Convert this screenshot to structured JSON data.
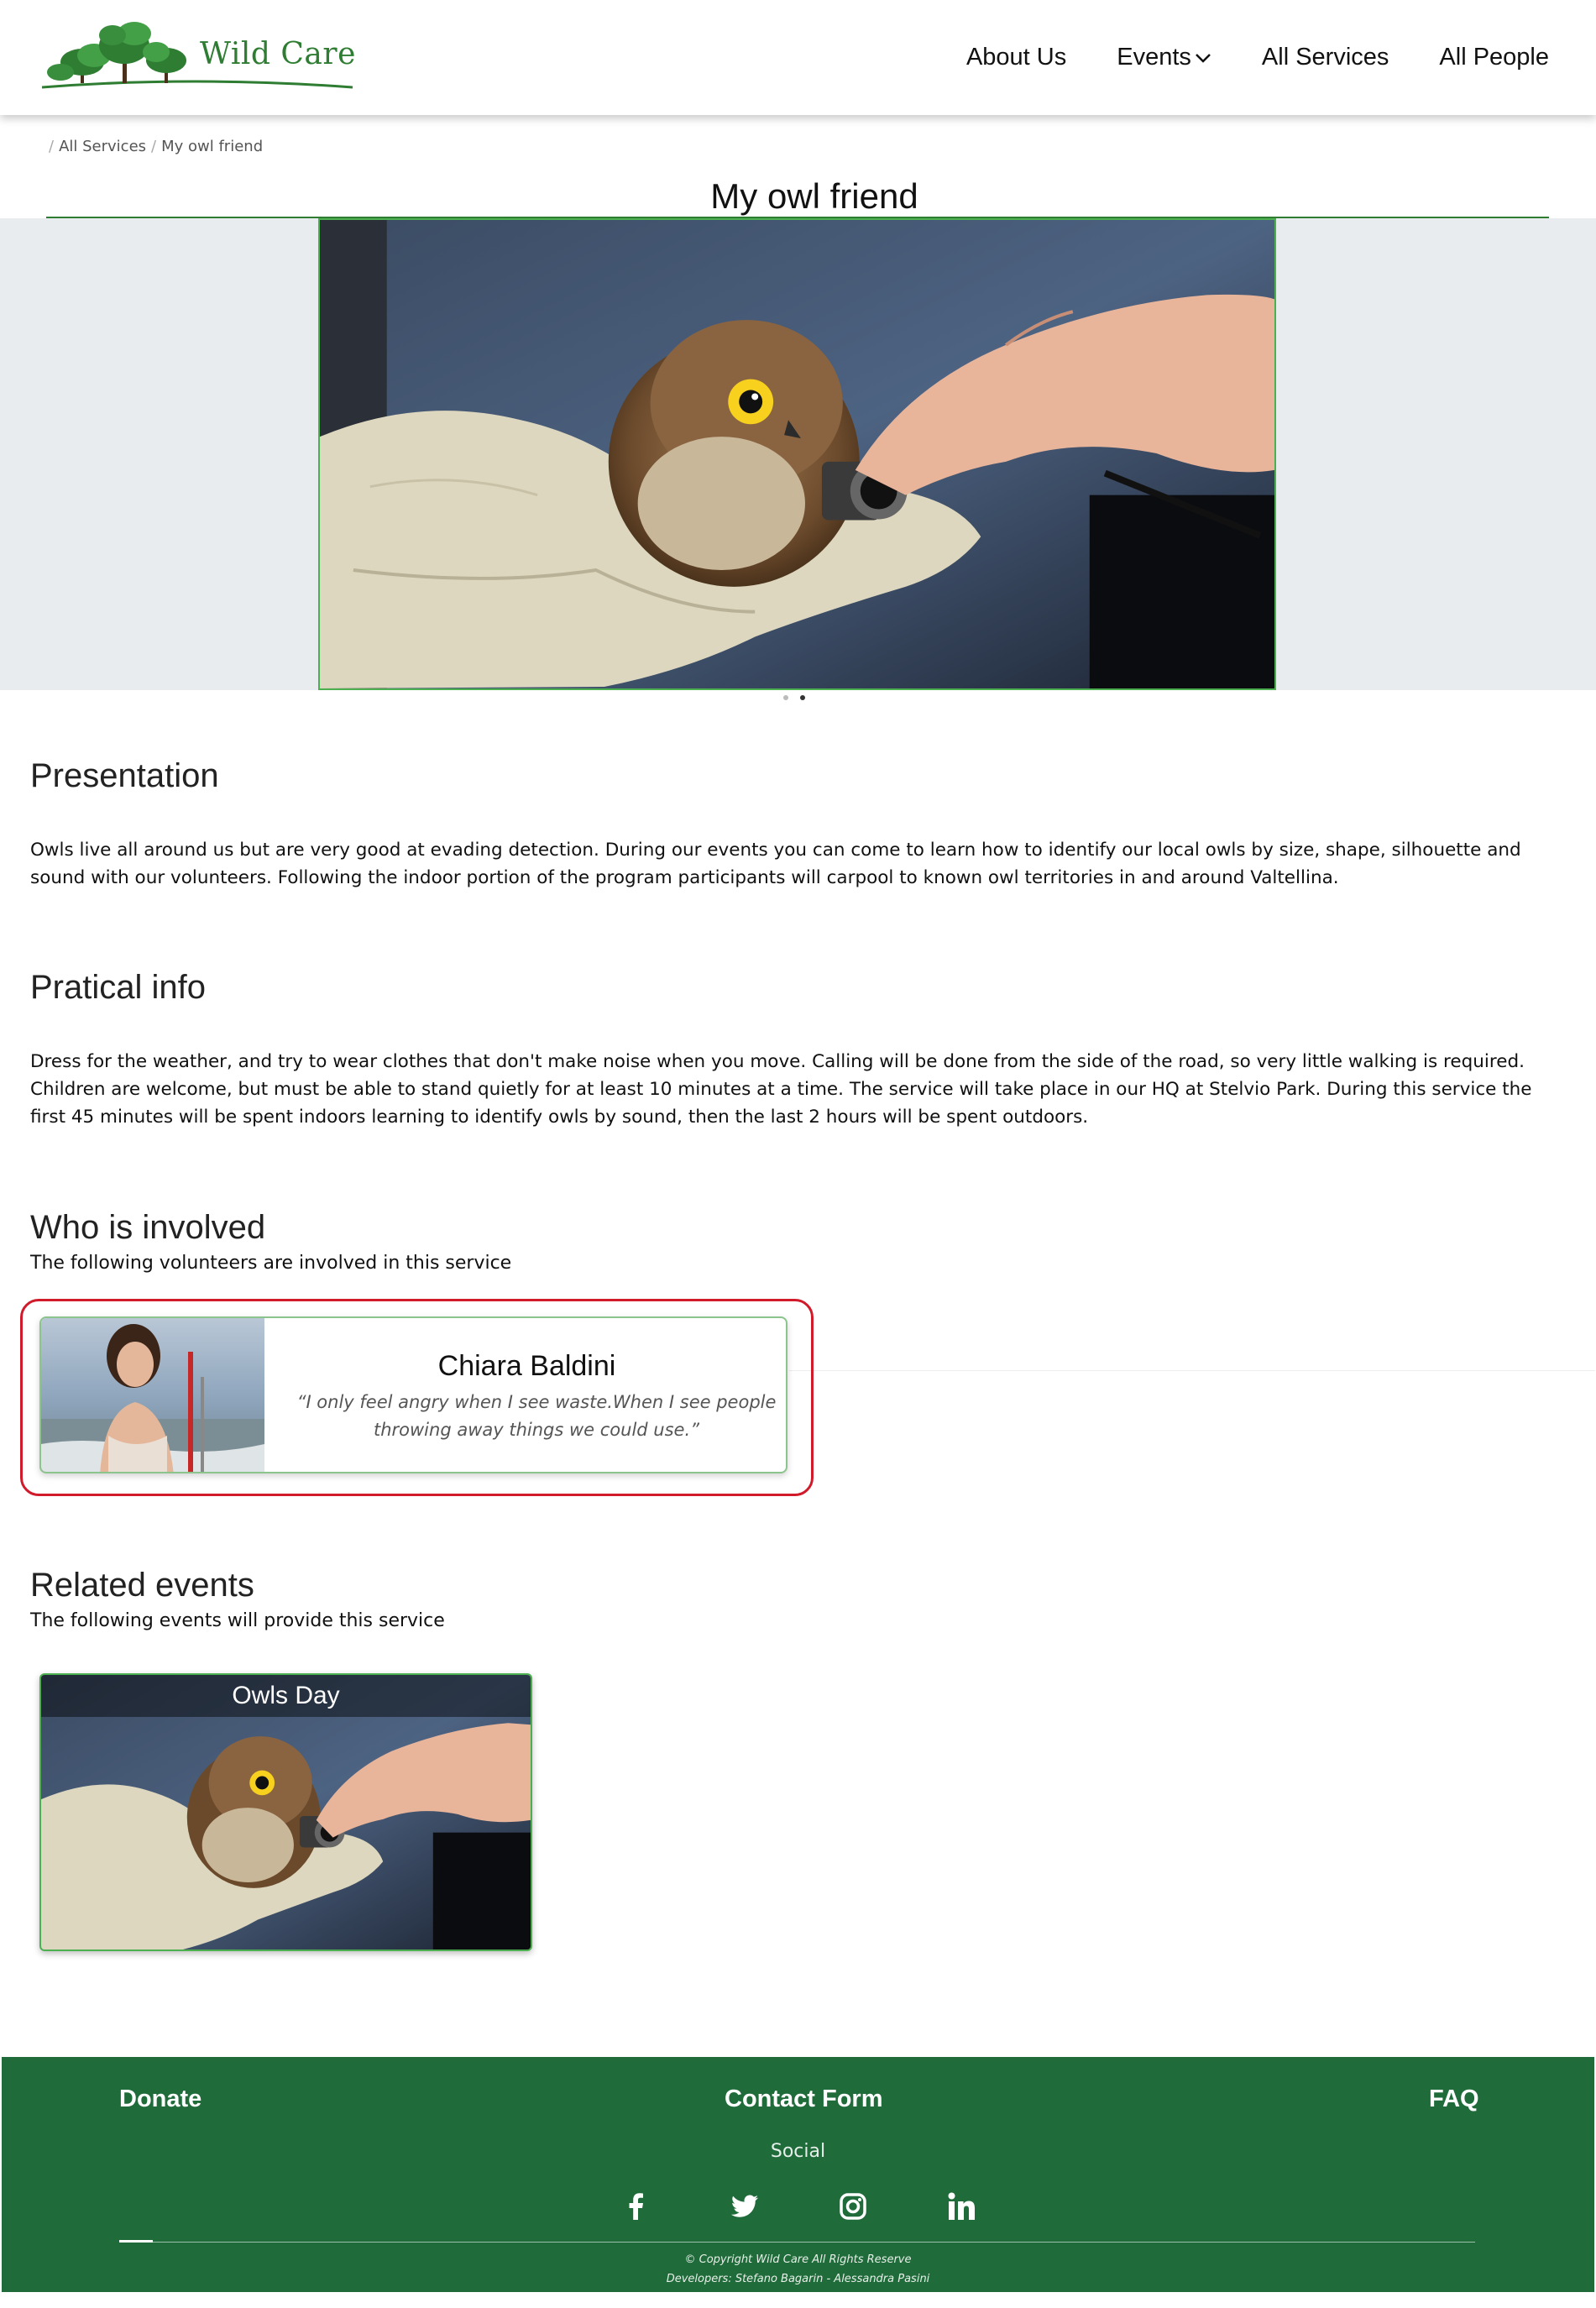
{
  "header": {
    "logo_text": "Wild Care",
    "nav": [
      {
        "label": "About Us"
      },
      {
        "label": "Events"
      },
      {
        "label": "All Services"
      },
      {
        "label": "All People"
      }
    ]
  },
  "breadcrumb": {
    "items": [
      "All Services",
      "My owl friend"
    ]
  },
  "page_title": "My owl friend",
  "carousel": {
    "slide_count": 2,
    "active_index": 1
  },
  "presentation": {
    "title": "Presentation",
    "text": "Owls live all around us but are very good at evading detection. During our events you can come to learn how to identify our local owls by size, shape, silhouette and sound with our volunteers. Following the indoor portion of the program participants will carpool to known owl territories in and around Valtellina."
  },
  "practical_info": {
    "title": "Pratical info",
    "text": "Dress for the weather, and try to wear clothes that don't make noise when you move. Calling will be done from the side of the road, so very little walking is required. Children are welcome, but must be able to stand quietly for at least 10 minutes at a time. The service will take place in our HQ at Stelvio Park. During this service the first 45 minutes will be spent indoors learning to identify owls by sound, then the last 2 hours will be spent outdoors."
  },
  "involved": {
    "title": "Who is involved",
    "subtitle": "The following volunteers are involved in this service",
    "people": [
      {
        "name": "Chiara Baldini",
        "quote": "“I only feel angry when I see waste.When I see people throwing away things we could use.”"
      }
    ]
  },
  "related": {
    "title": "Related events",
    "subtitle": "The following events will provide this service",
    "events": [
      {
        "label": "Owls Day"
      }
    ]
  },
  "footer": {
    "donate": "Donate",
    "contact": "Contact Form",
    "faq": "FAQ",
    "social_label": "Social",
    "social_icons": [
      "facebook-icon",
      "twitter-icon",
      "instagram-icon",
      "linkedin-icon"
    ],
    "copyright": "© Copyright Wild Care All Rights Reserve",
    "developers": "Developers: Stefano Bagarin - Alessandra Pasini"
  },
  "colors": {
    "brand_green": "#2e7d32",
    "footer_green": "#1f6b3a",
    "highlight_red": "#d11a2a",
    "hero_band": "#e9ecef"
  }
}
